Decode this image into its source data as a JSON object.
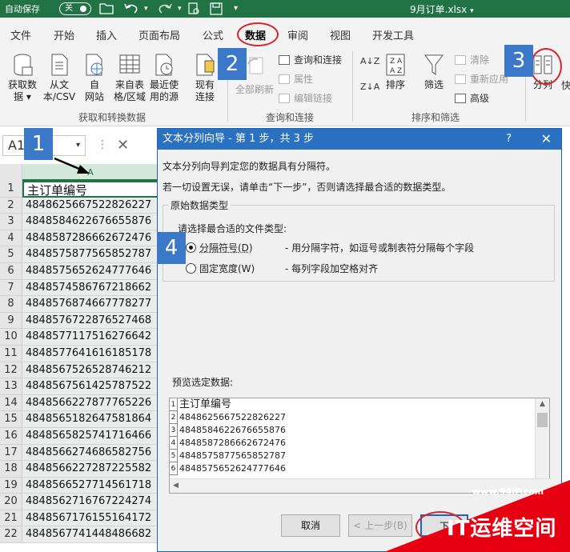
{
  "titlebar": {
    "autosave_label": "自动保存",
    "toggle_state": "关",
    "filename": "9月订单.xlsx",
    "filename_caret": "▾",
    "bg_color": "#217346"
  },
  "tabs": [
    {
      "label": "文件"
    },
    {
      "label": "开始"
    },
    {
      "label": "插入"
    },
    {
      "label": "页面布局"
    },
    {
      "label": "公式"
    },
    {
      "label": "数据",
      "active": true
    },
    {
      "label": "审阅"
    },
    {
      "label": "视图"
    },
    {
      "label": "开发工具"
    }
  ],
  "ribbon": {
    "get_data_line1": "获取数",
    "get_data_line2": "据 ▾",
    "from_csv_line1": "从文",
    "from_csv_line2": "本/CSV",
    "from_web_line1": "自",
    "from_web_line2": "网站",
    "from_table_line1": "来自表",
    "from_table_line2": "格/区域",
    "recent_line1": "最近使",
    "recent_line2": "用的源",
    "existing_line1": "现有",
    "existing_line2": "连接",
    "group_get_transform": "获取和转换数据",
    "refresh_all_label": "全部刷新",
    "queries_connections": "查询和连接",
    "properties": "属性",
    "edit_links": "编辑链接",
    "group_queries": "查询和连接",
    "sort_az": "A↓Z",
    "sort_za": "Z↓A",
    "sort_label": "排序",
    "filter_label": "筛选",
    "clear": "清除",
    "reapply": "重新应用",
    "advanced": "高级",
    "group_sort_filter": "排序和筛选",
    "text_to_columns": "分列",
    "flash_fill_partial": "快"
  },
  "badges": [
    "1",
    "2",
    "3",
    "4"
  ],
  "formula_bar": {
    "name_box": "A1",
    "name_caret": "▾",
    "sep": "⋮",
    "cancel": "✕"
  },
  "grid": {
    "column_header": "A",
    "rows": [
      {
        "n": "1",
        "v": "主订单编号"
      },
      {
        "n": "2",
        "v": "4848625667522826227"
      },
      {
        "n": "3",
        "v": "4848584622676655876"
      },
      {
        "n": "4",
        "v": "4848587286662672476"
      },
      {
        "n": "5",
        "v": "4848575877565852787"
      },
      {
        "n": "6",
        "v": "4848575652624777646"
      },
      {
        "n": "7",
        "v": "4848574586767218662"
      },
      {
        "n": "8",
        "v": "4848576874667778277"
      },
      {
        "n": "9",
        "v": "4848576722876527468"
      },
      {
        "n": "10",
        "v": "4848577117516276642"
      },
      {
        "n": "11",
        "v": "4848577641616185178"
      },
      {
        "n": "12",
        "v": "4848567526528746212"
      },
      {
        "n": "13",
        "v": "4848567561425787522"
      },
      {
        "n": "14",
        "v": "4848566227877765226"
      },
      {
        "n": "15",
        "v": "4848565182647581864"
      },
      {
        "n": "16",
        "v": "4848565825741716466"
      },
      {
        "n": "17",
        "v": "4848566274686582756"
      },
      {
        "n": "18",
        "v": "4848566227287225582"
      },
      {
        "n": "19",
        "v": "4848566527714561718"
      },
      {
        "n": "20",
        "v": "4848562716767224274"
      },
      {
        "n": "21",
        "v": "4848567176155164172"
      },
      {
        "n": "22",
        "v": "4848567741448486682"
      }
    ]
  },
  "dialog": {
    "title": "文本分列向导 - 第 1 步，共 3 步",
    "help": "?",
    "close": "✕",
    "line1": "文本分列向导判定您的数据具有分隔符。",
    "line2": "若一切设置无误，请单击“下一步”，否则请选择最合适的数据类型。",
    "group_title": "原始数据类型",
    "choose_label": "请选择最合适的文件类型:",
    "option_delimited": "分隔符号(D)",
    "option_delimited_desc": "- 用分隔字符，如逗号或制表符分隔每个字段",
    "option_fixed": "固定宽度(W)",
    "option_fixed_desc": "- 每列字段加空格对齐",
    "preview_label": "预览选定数据:",
    "preview_rows": [
      {
        "n": "1",
        "v": "主订单编号"
      },
      {
        "n": "2",
        "v": "4848625667522826227"
      },
      {
        "n": "3",
        "v": "4848584622676655876"
      },
      {
        "n": "4",
        "v": "4848587286662672476"
      },
      {
        "n": "5",
        "v": "4848575877565852787"
      },
      {
        "n": "6",
        "v": "4848575652624777646"
      }
    ],
    "cancel_btn": "取消",
    "back_btn": "< 上一步(B)",
    "next_btn": "下"
  },
  "watermark": {
    "url": "www.94IP.com",
    "text": "IT运维空间"
  }
}
